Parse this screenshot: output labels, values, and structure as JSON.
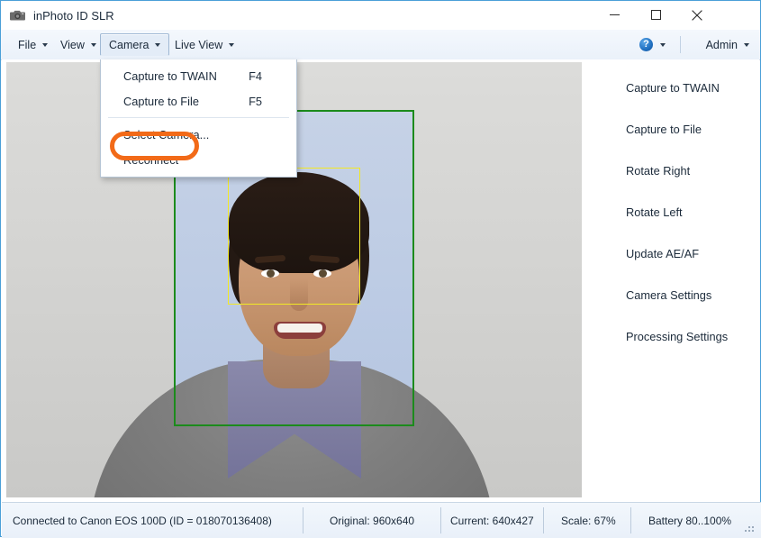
{
  "window": {
    "title": "inPhoto ID SLR",
    "app_icon": "camera-icon",
    "minimize_label": "Minimize",
    "maximize_label": "Maximize",
    "close_label": "Close",
    "border_color": "#4a9fd8"
  },
  "menubar": {
    "items": [
      {
        "label": "File",
        "active": false
      },
      {
        "label": "View",
        "active": false
      },
      {
        "label": "Camera",
        "active": true
      },
      {
        "label": "Live View",
        "active": false
      }
    ],
    "help": {
      "glyph": "?",
      "label": "Help"
    },
    "admin": {
      "label": "Admin"
    }
  },
  "dropdown": {
    "open_for": "Camera",
    "items": [
      {
        "label": "Capture to TWAIN",
        "shortcut": "F4"
      },
      {
        "label": "Capture to File",
        "shortcut": "F5"
      },
      {
        "separator": true
      },
      {
        "label": "Select Camera...",
        "shortcut": ""
      },
      {
        "label": "Reconnect",
        "shortcut": "",
        "highlighted": true
      }
    ],
    "highlight_color": "#f26a18"
  },
  "preview": {
    "crop_box": {
      "color": "#1c8b1c",
      "name": "crop-rectangle"
    },
    "face_box": {
      "color": "#f2e825",
      "name": "face-detection-rectangle"
    }
  },
  "actions": [
    {
      "label": "Capture to TWAIN"
    },
    {
      "label": "Capture to File"
    },
    {
      "label": "Rotate Right"
    },
    {
      "label": "Rotate Left"
    },
    {
      "label": "Update AE/AF"
    },
    {
      "label": "Camera Settings"
    },
    {
      "label": "Processing Settings"
    }
  ],
  "statusbar": {
    "connection": "Connected to Canon EOS 100D (ID = 018070136408)",
    "original": "Original: 960x640",
    "current": "Current: 640x427",
    "scale": "Scale: 67%",
    "battery": "Battery 80..100%"
  }
}
